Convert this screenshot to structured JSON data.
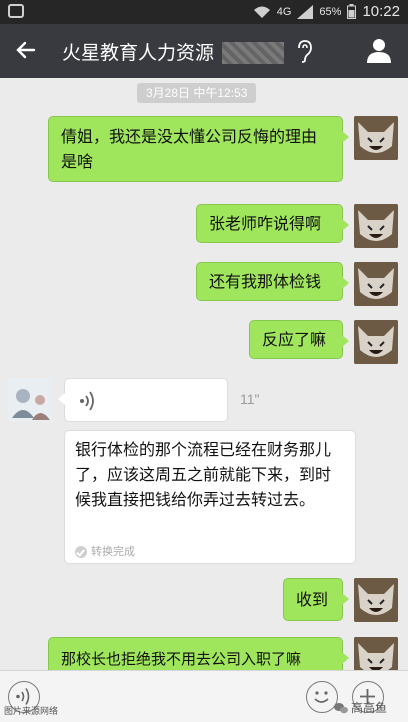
{
  "status_bar": {
    "network": "4G",
    "battery": "65%",
    "time": "10:22"
  },
  "header": {
    "title": "火星教育人力资源"
  },
  "conversation": {
    "timestamp": "3月28日 中午12:53",
    "messages": [
      {
        "sender": "self",
        "text": "倩姐，我还是没太懂公司反悔的理由是啥"
      },
      {
        "sender": "self",
        "text": "张老师咋说得啊"
      },
      {
        "sender": "self",
        "text": "还有我那体检钱"
      },
      {
        "sender": "self",
        "text": "反应了嘛"
      },
      {
        "sender": "other",
        "type": "voice",
        "duration": "11\""
      },
      {
        "sender": "other",
        "type": "voice-transcript",
        "text": "银行体检的那个流程已经在财务那儿了，应该这周五之前就能下来，到时候我直接把钱给你弄过去转过去。",
        "status": "转换完成"
      },
      {
        "sender": "self",
        "text": "收到"
      },
      {
        "sender": "self",
        "text": "那校长也拒绝我不用去公司入职了嘛"
      }
    ]
  },
  "watermark": {
    "left": "图片来源网络",
    "right": "高高鱼"
  },
  "colors": {
    "bubble_self": "#9fe65d",
    "bubble_other": "#ffffff",
    "header_bg": "#393a3f",
    "chat_bg": "#ebebeb"
  },
  "icons": [
    "back-arrow-icon",
    "earpiece-icon",
    "person-icon",
    "voice-wave-icon",
    "voice-input-icon",
    "emoji-icon",
    "plus-icon",
    "wifi-icon",
    "signal-icon",
    "battery-icon",
    "notification-icon"
  ]
}
